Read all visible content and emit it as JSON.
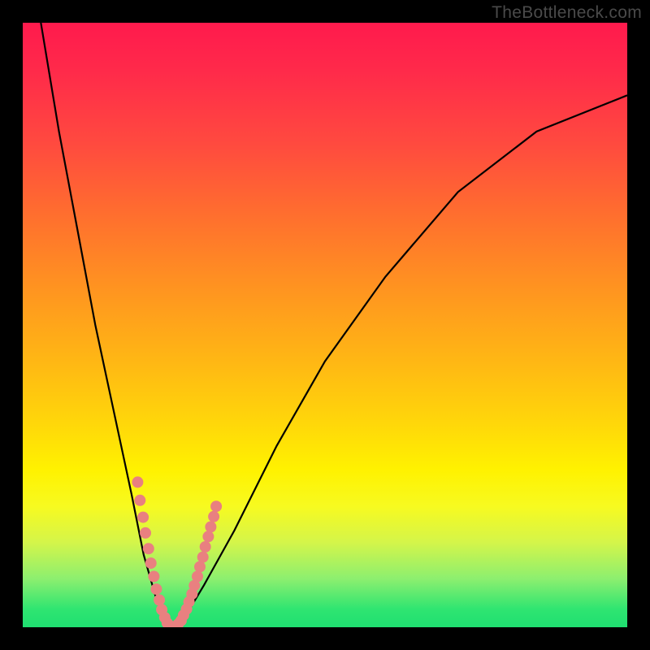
{
  "watermark": "TheBottleneck.com",
  "colors": {
    "marker": "#e98080",
    "curve": "#000000",
    "frame_bg": "#000000"
  },
  "chart_data": {
    "type": "line",
    "title": "",
    "xlabel": "",
    "ylabel": "",
    "xlim": [
      0,
      100
    ],
    "ylim": [
      0,
      100
    ],
    "gradient_stops": [
      {
        "pos": 0,
        "color": "#ff1a4d"
      },
      {
        "pos": 50,
        "color": "#ffb714"
      },
      {
        "pos": 75,
        "color": "#fff200"
      },
      {
        "pos": 100,
        "color": "#1fdf71"
      }
    ],
    "series": [
      {
        "name": "bottleneck-curve",
        "x": [
          3,
          6,
          9,
          12,
          15,
          18,
          20,
          22,
          23.5,
          25,
          27,
          30,
          35,
          42,
          50,
          60,
          72,
          85,
          100
        ],
        "y": [
          100,
          82,
          66,
          50,
          36,
          22,
          12,
          5,
          1,
          0,
          2,
          7,
          16,
          30,
          44,
          58,
          72,
          82,
          88
        ]
      }
    ],
    "markers": {
      "name": "highlighted-points",
      "points": [
        {
          "x": 19.0,
          "y": 24.0
        },
        {
          "x": 19.4,
          "y": 21.0
        },
        {
          "x": 19.9,
          "y": 18.2
        },
        {
          "x": 20.3,
          "y": 15.6
        },
        {
          "x": 20.8,
          "y": 13.0
        },
        {
          "x": 21.2,
          "y": 10.6
        },
        {
          "x": 21.7,
          "y": 8.4
        },
        {
          "x": 22.1,
          "y": 6.3
        },
        {
          "x": 22.6,
          "y": 4.5
        },
        {
          "x": 23.0,
          "y": 2.9
        },
        {
          "x": 23.5,
          "y": 1.6
        },
        {
          "x": 23.9,
          "y": 0.7
        },
        {
          "x": 24.4,
          "y": 0.2
        },
        {
          "x": 24.8,
          "y": 0.0
        },
        {
          "x": 25.3,
          "y": 0.1
        },
        {
          "x": 25.7,
          "y": 0.5
        },
        {
          "x": 26.2,
          "y": 1.1
        },
        {
          "x": 26.6,
          "y": 2.0
        },
        {
          "x": 27.1,
          "y": 3.0
        },
        {
          "x": 27.5,
          "y": 4.2
        },
        {
          "x": 28.0,
          "y": 5.5
        },
        {
          "x": 28.4,
          "y": 6.9
        },
        {
          "x": 28.9,
          "y": 8.4
        },
        {
          "x": 29.3,
          "y": 10.0
        },
        {
          "x": 29.8,
          "y": 11.6
        },
        {
          "x": 30.2,
          "y": 13.3
        },
        {
          "x": 30.7,
          "y": 15.0
        },
        {
          "x": 31.1,
          "y": 16.6
        },
        {
          "x": 31.6,
          "y": 18.3
        },
        {
          "x": 32.0,
          "y": 20.0
        }
      ]
    }
  }
}
